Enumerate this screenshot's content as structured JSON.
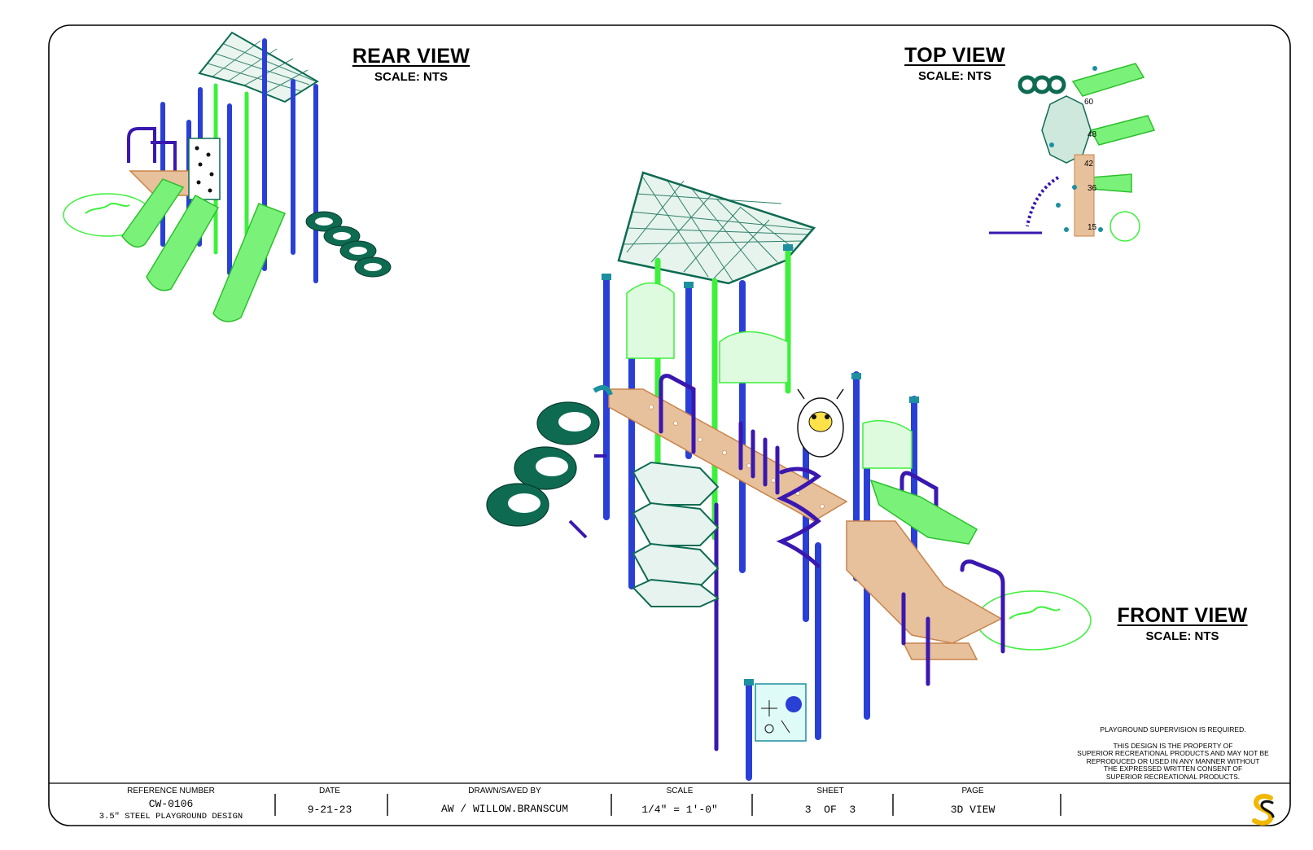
{
  "views": {
    "rear": {
      "title": "REAR VIEW",
      "scale": "SCALE: NTS"
    },
    "top": {
      "title": "TOP VIEW",
      "scale": "SCALE: NTS"
    },
    "front": {
      "title": "FRONT VIEW",
      "scale": "SCALE: NTS"
    }
  },
  "top_view_labels": [
    "60",
    "48",
    "42",
    "36",
    "15"
  ],
  "notes": {
    "supervision": "PLAYGROUND SUPERVISION IS REQUIRED.",
    "property_lines": [
      "THIS DESIGN IS THE PROPERTY OF",
      "SUPERIOR RECREATIONAL PRODUCTS AND MAY NOT BE",
      "REPRODUCED OR USED IN ANY MANNER WITHOUT",
      "THE EXPRESSED WRITTEN CONSENT OF",
      "SUPERIOR RECREATIONAL PRODUCTS."
    ]
  },
  "title_block": {
    "reference_number": {
      "label": "REFERENCE NUMBER",
      "value": "CW-0106",
      "subtitle": "3.5\" STEEL PLAYGROUND DESIGN"
    },
    "date": {
      "label": "DATE",
      "value": "9-21-23"
    },
    "drawn": {
      "label": "DRAWN/SAVED BY",
      "value": "AW / WILLOW.BRANSCUM"
    },
    "scale": {
      "label": "SCALE",
      "value": "1/4\" = 1'-0\""
    },
    "sheet": {
      "label": "SHEET",
      "value": "3  OF  3"
    },
    "page": {
      "label": "PAGE",
      "value": "3D VIEW"
    },
    "logo": "S"
  },
  "colors": {
    "roof": "#0e6b52",
    "slide": "#3cf03c",
    "post_blue": "#2a3fd6",
    "rail_purple": "#3a18b0",
    "deck": "#c8844a",
    "tire": "#0e6b52",
    "cap": "#1c8fa0"
  }
}
